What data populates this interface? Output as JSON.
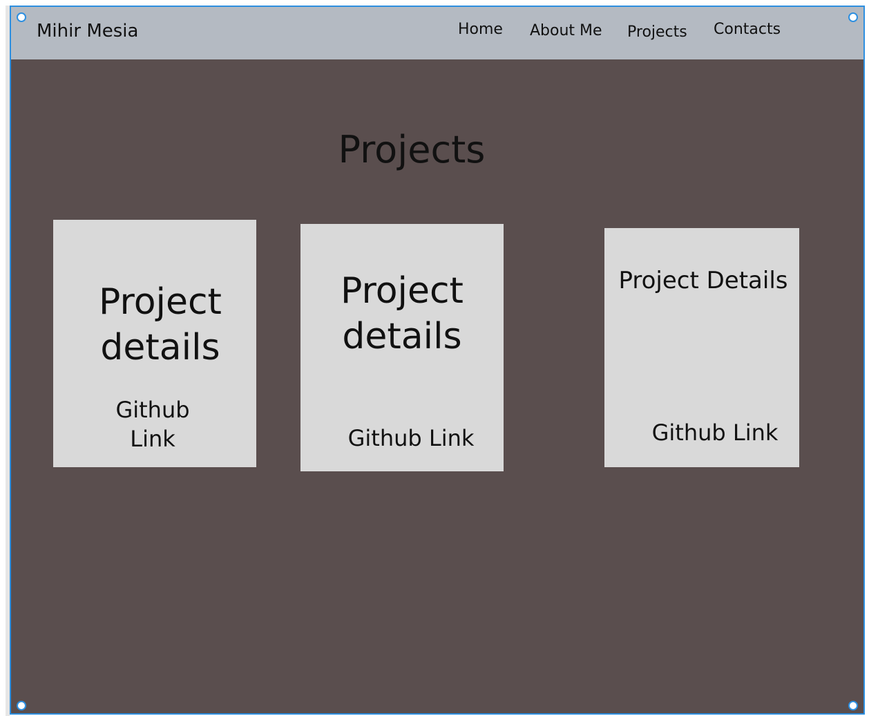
{
  "navbar": {
    "brand": "Mihir Mesia",
    "links": [
      "Home",
      "About Me",
      "Projects",
      "Contacts"
    ]
  },
  "main": {
    "title": "Projects",
    "cards": [
      {
        "details": "Project details",
        "link": "Github Link"
      },
      {
        "details": "Project details",
        "link": "Github Link"
      },
      {
        "details": "Project Details",
        "link": "Github Link"
      }
    ]
  },
  "colors": {
    "navbar_bg": "#b4bac2",
    "page_bg": "#5a4e4e",
    "card_bg": "#d9d9d9",
    "selection_accent": "#2d8fe0"
  }
}
